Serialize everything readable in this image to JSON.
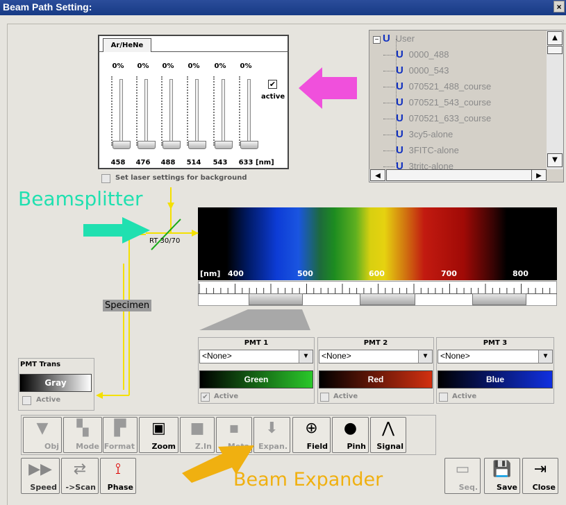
{
  "window": {
    "title": "Beam Path Setting:",
    "close": "×"
  },
  "laser": {
    "tab": "Ar/HeNe",
    "percents": [
      "0%",
      "0%",
      "0%",
      "0%",
      "0%",
      "0%"
    ],
    "wavelengths": [
      "458",
      "476",
      "488",
      "514",
      "543",
      "633"
    ],
    "unit": "[nm]",
    "active_label": "active",
    "active_check": "✔",
    "bg_label": "Set laser settings for background"
  },
  "tree": {
    "root": "User",
    "items": [
      "0000_488",
      "0000_543",
      "070521_488_course",
      "070521_543_course",
      "070521_633_course",
      "3cy5-alone",
      "3FITC-alone",
      "3tritc-alone"
    ],
    "icon": "U",
    "expander": "−"
  },
  "spectrum": {
    "unit": "[nm]",
    "ticks": [
      "400",
      "500",
      "600",
      "700",
      "800"
    ],
    "splitter": "RT 30/70",
    "specimen": "Specimen"
  },
  "pmt": [
    {
      "title": "PMT 1",
      "value": "<None>",
      "channel": "Green",
      "color": "#2ac82a",
      "active": "Active",
      "checked": "✔"
    },
    {
      "title": "PMT 2",
      "value": "<None>",
      "channel": "Red",
      "color": "#d23010",
      "active": "Active",
      "checked": ""
    },
    {
      "title": "PMT 3",
      "value": "<None>",
      "channel": "Blue",
      "color": "#1030e0",
      "active": "Active",
      "checked": ""
    }
  ],
  "pmtTrans": {
    "title": "PMT Trans",
    "channel": "Gray",
    "active": "Active"
  },
  "toolbar1": [
    {
      "label": "Obj",
      "icon": "obj-icon",
      "dis": true
    },
    {
      "label": "Mode",
      "icon": "mode-icon",
      "dis": true
    },
    {
      "label": "Format",
      "icon": "format-icon",
      "dis": true
    },
    {
      "label": "Zoom",
      "icon": "zoom-icon",
      "dis": false
    },
    {
      "label": "Z.In",
      "icon": "zin-icon",
      "dis": true
    },
    {
      "label": "Meta",
      "icon": "meta-icon",
      "dis": true
    },
    {
      "label": "Expan.",
      "icon": "expander-icon",
      "dis": true
    },
    {
      "label": "Field",
      "icon": "field-icon",
      "dis": false
    },
    {
      "label": "Pinh",
      "icon": "pinhole-icon",
      "dis": false
    },
    {
      "label": "Signal",
      "icon": "signal-icon",
      "dis": false
    }
  ],
  "toolbar2": [
    {
      "label": "Speed"
    },
    {
      "label": "->Scan"
    },
    {
      "label": "Phase"
    }
  ],
  "toolbar3": [
    {
      "label": "Seq."
    },
    {
      "label": "Save"
    },
    {
      "label": "Close"
    }
  ],
  "annotations": {
    "beamsplitter": "Beamsplitter",
    "expander": "Beam Expander"
  },
  "colors": {
    "title": "#1f4190",
    "arrow_pink": "#f050dc",
    "arrow_teal": "#20e0b0",
    "arrow_orange": "#f0b010",
    "beam": "#f4e000"
  }
}
